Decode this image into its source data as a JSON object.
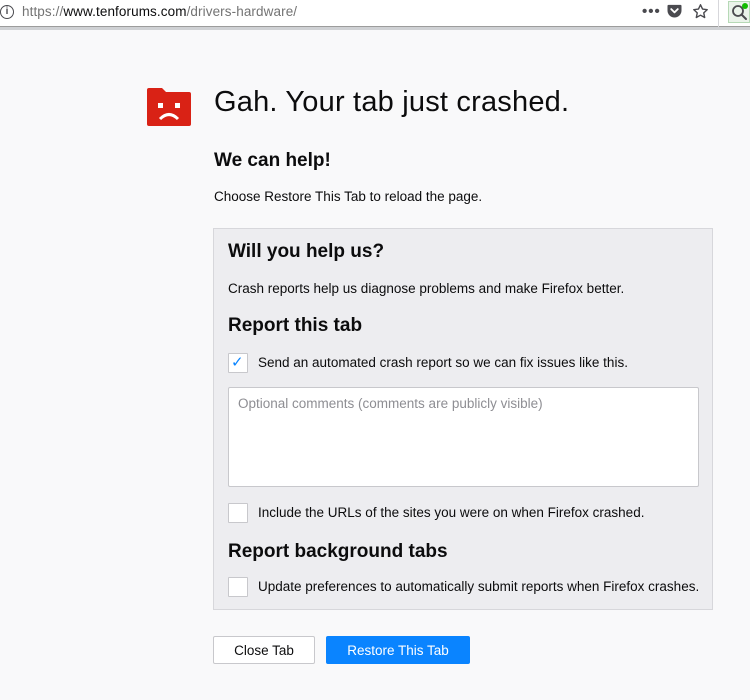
{
  "urlbar": {
    "url_prefix": "https://",
    "url_domain": "www.tenforums.com",
    "url_path": "/drivers-hardware/",
    "info_glyph": "i",
    "page_actions_glyph": "•••",
    "icons": [
      "info-icon",
      "page-actions-icon",
      "pocket-icon",
      "bookmark-star-icon",
      "search-extension-icon"
    ]
  },
  "crash": {
    "icon": "sad-folder-icon",
    "title": "Gah. Your tab just crashed.",
    "help_heading": "We can help!",
    "help_text": "Choose Restore This Tab to reload the page."
  },
  "panel": {
    "heading": "Will you help us?",
    "description": "Crash reports help us diagnose problems and make Firefox better.",
    "report_tab_heading": "Report this tab",
    "send_report": {
      "label": "Send an automated crash report so we can fix issues like this.",
      "checked": true,
      "check_glyph": "✓"
    },
    "comments": {
      "placeholder": "Optional comments (comments are publicly visible)",
      "value": ""
    },
    "include_urls": {
      "label": "Include the URLs of the sites you were on when Firefox crashed.",
      "checked": false
    },
    "background_heading": "Report background tabs",
    "auto_submit": {
      "label": "Update preferences to automatically submit reports when Firefox crashes.",
      "checked": false
    }
  },
  "buttons": {
    "close_tab": "Close Tab",
    "restore_tab": "Restore This Tab"
  },
  "colors": {
    "accent": "#0a84ff",
    "crash_icon": "#d92215",
    "page_background": "#f9f9fa",
    "panel_background": "#ededf0"
  }
}
